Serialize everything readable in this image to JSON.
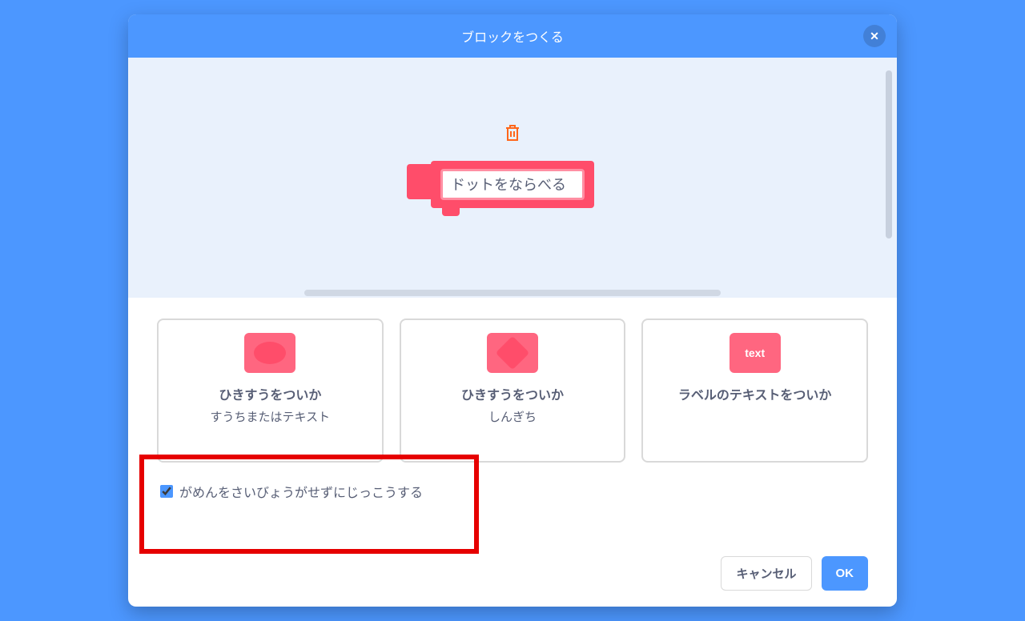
{
  "header": {
    "title": "ブロックをつくる"
  },
  "preview": {
    "blockName": "ドットをならべる"
  },
  "options": {
    "cards": [
      {
        "title": "ひきすうをついか",
        "sub": "すうちまたはテキスト"
      },
      {
        "title": "ひきすうをついか",
        "sub": "しんぎち"
      },
      {
        "title": "ラベルのテキストをついか",
        "sub": ""
      }
    ],
    "textIconLabel": "text"
  },
  "checkbox": {
    "label": "がめんをさいびょうがせずにじっこうする",
    "checked": true
  },
  "footer": {
    "cancel": "キャンセル",
    "ok": "OK"
  }
}
